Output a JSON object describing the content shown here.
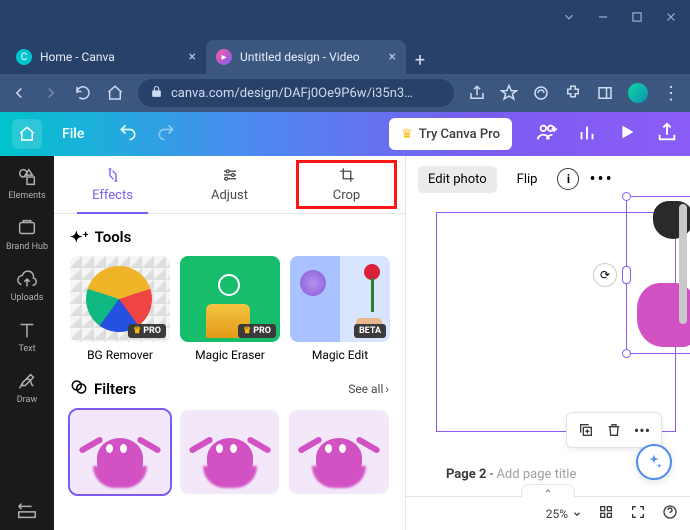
{
  "window": {
    "controls": [
      "notch",
      "min",
      "max",
      "close"
    ]
  },
  "browser": {
    "tabs": [
      {
        "label": "Home - Canva",
        "favicon": "C",
        "active": false
      },
      {
        "label": "Untitled design - Video",
        "favicon": "▶",
        "active": true
      }
    ],
    "url": "canva.com/design/DAFj0Oe9P6w/i35n3…"
  },
  "topbar": {
    "file": "File",
    "try_pro": "Try Canva Pro"
  },
  "sidebar": {
    "items": [
      {
        "id": "elements",
        "label": "Elements"
      },
      {
        "id": "brandhub",
        "label": "Brand Hub"
      },
      {
        "id": "uploads",
        "label": "Uploads"
      },
      {
        "id": "text",
        "label": "Text"
      },
      {
        "id": "draw",
        "label": "Draw"
      }
    ]
  },
  "panel": {
    "tabs": [
      {
        "id": "effects",
        "label": "Effects"
      },
      {
        "id": "adjust",
        "label": "Adjust"
      },
      {
        "id": "crop",
        "label": "Crop"
      }
    ],
    "tools_heading": "Tools",
    "tools": [
      {
        "id": "bgremover",
        "label": "BG Remover",
        "badge": "PRO"
      },
      {
        "id": "magiceraser",
        "label": "Magic Eraser",
        "badge": "PRO"
      },
      {
        "id": "magicedit",
        "label": "Magic Edit",
        "badge": "BETA"
      }
    ],
    "filters_heading": "Filters",
    "see_all": "See all"
  },
  "context_bar": {
    "edit_photo": "Edit photo",
    "flip": "Flip"
  },
  "page": {
    "label_prefix": "Page 2",
    "separator": " - ",
    "hint": "Add page title"
  },
  "bottom": {
    "zoom": "25%"
  }
}
